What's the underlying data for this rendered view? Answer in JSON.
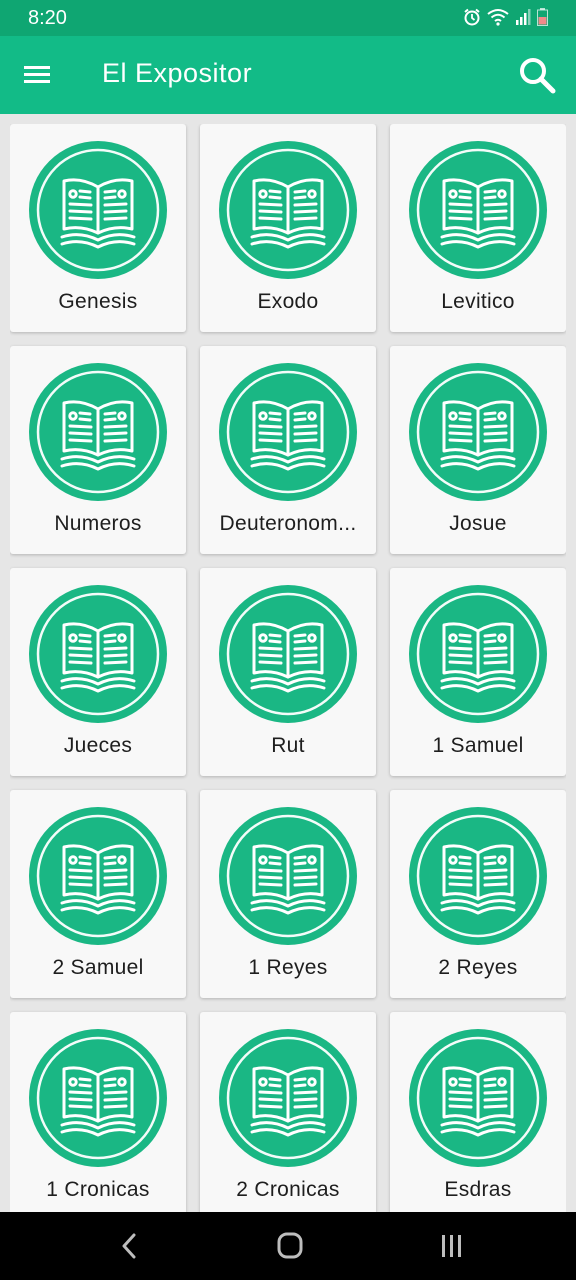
{
  "status_bar": {
    "time": "8:20"
  },
  "app_bar": {
    "title": "El Expositor"
  },
  "books": [
    "Genesis",
    "Exodo",
    "Levitico",
    "Numeros",
    "Deuteronom...",
    "Josue",
    "Jueces",
    "Rut",
    "1 Samuel",
    "2 Samuel",
    "1 Reyes",
    "2 Reyes",
    "1 Cronicas",
    "2 Cronicas",
    "Esdras"
  ],
  "icons": {
    "menu": "hamburger-menu-icon",
    "search": "search-icon",
    "book": "open-book-icon",
    "nav_back": "back-chevron-icon",
    "nav_home": "home-icon",
    "nav_recents": "recent-apps-icon"
  },
  "colors": {
    "status_bar": "#0fa672",
    "app_bar": "#12bb87",
    "icon_circle": "#1ab784"
  }
}
